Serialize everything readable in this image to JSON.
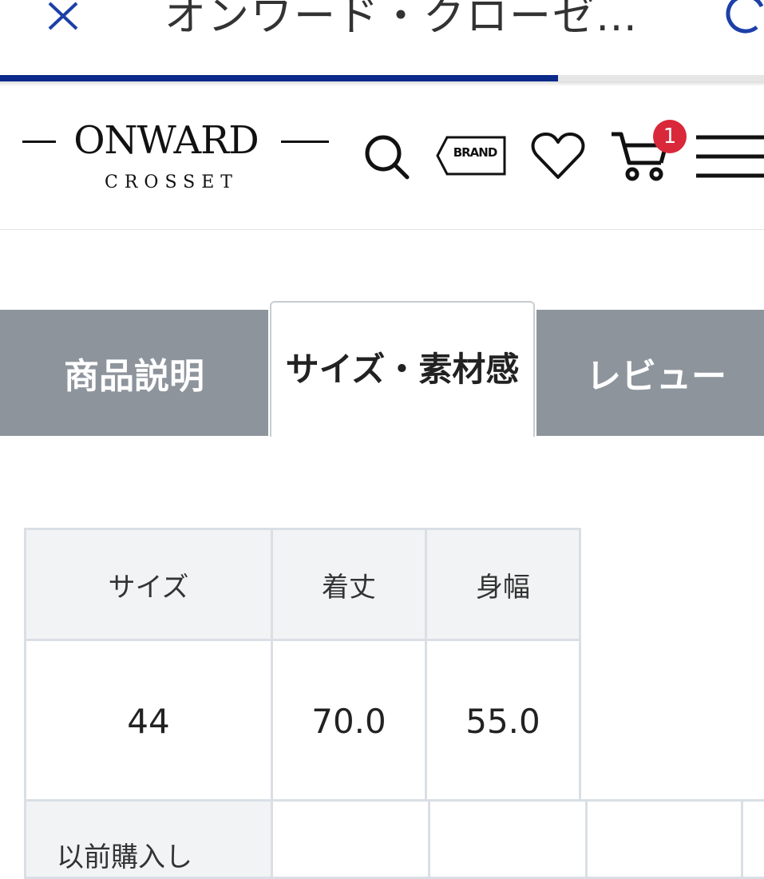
{
  "browser": {
    "title": "オンワード・クローゼ…",
    "progress_percent": 73
  },
  "header": {
    "logo_main": "ONWARD",
    "logo_sub": "CROSSET",
    "brand_label": "BRAND",
    "cart_count": "1"
  },
  "tabs": [
    {
      "label": "商品説明",
      "active": false
    },
    {
      "label": "サイズ・素材感",
      "active": true
    },
    {
      "label": "レビュー",
      "active": false
    }
  ],
  "size_table": {
    "headers": [
      "サイズ",
      "着丈",
      "身幅"
    ],
    "rows": [
      [
        "44",
        "70.0",
        "55.0"
      ]
    ],
    "next_row_label": "以前購入し"
  },
  "colors": {
    "progress": "#0b2a8a",
    "tab_inactive": "#8e949c",
    "badge": "#d9283a"
  }
}
